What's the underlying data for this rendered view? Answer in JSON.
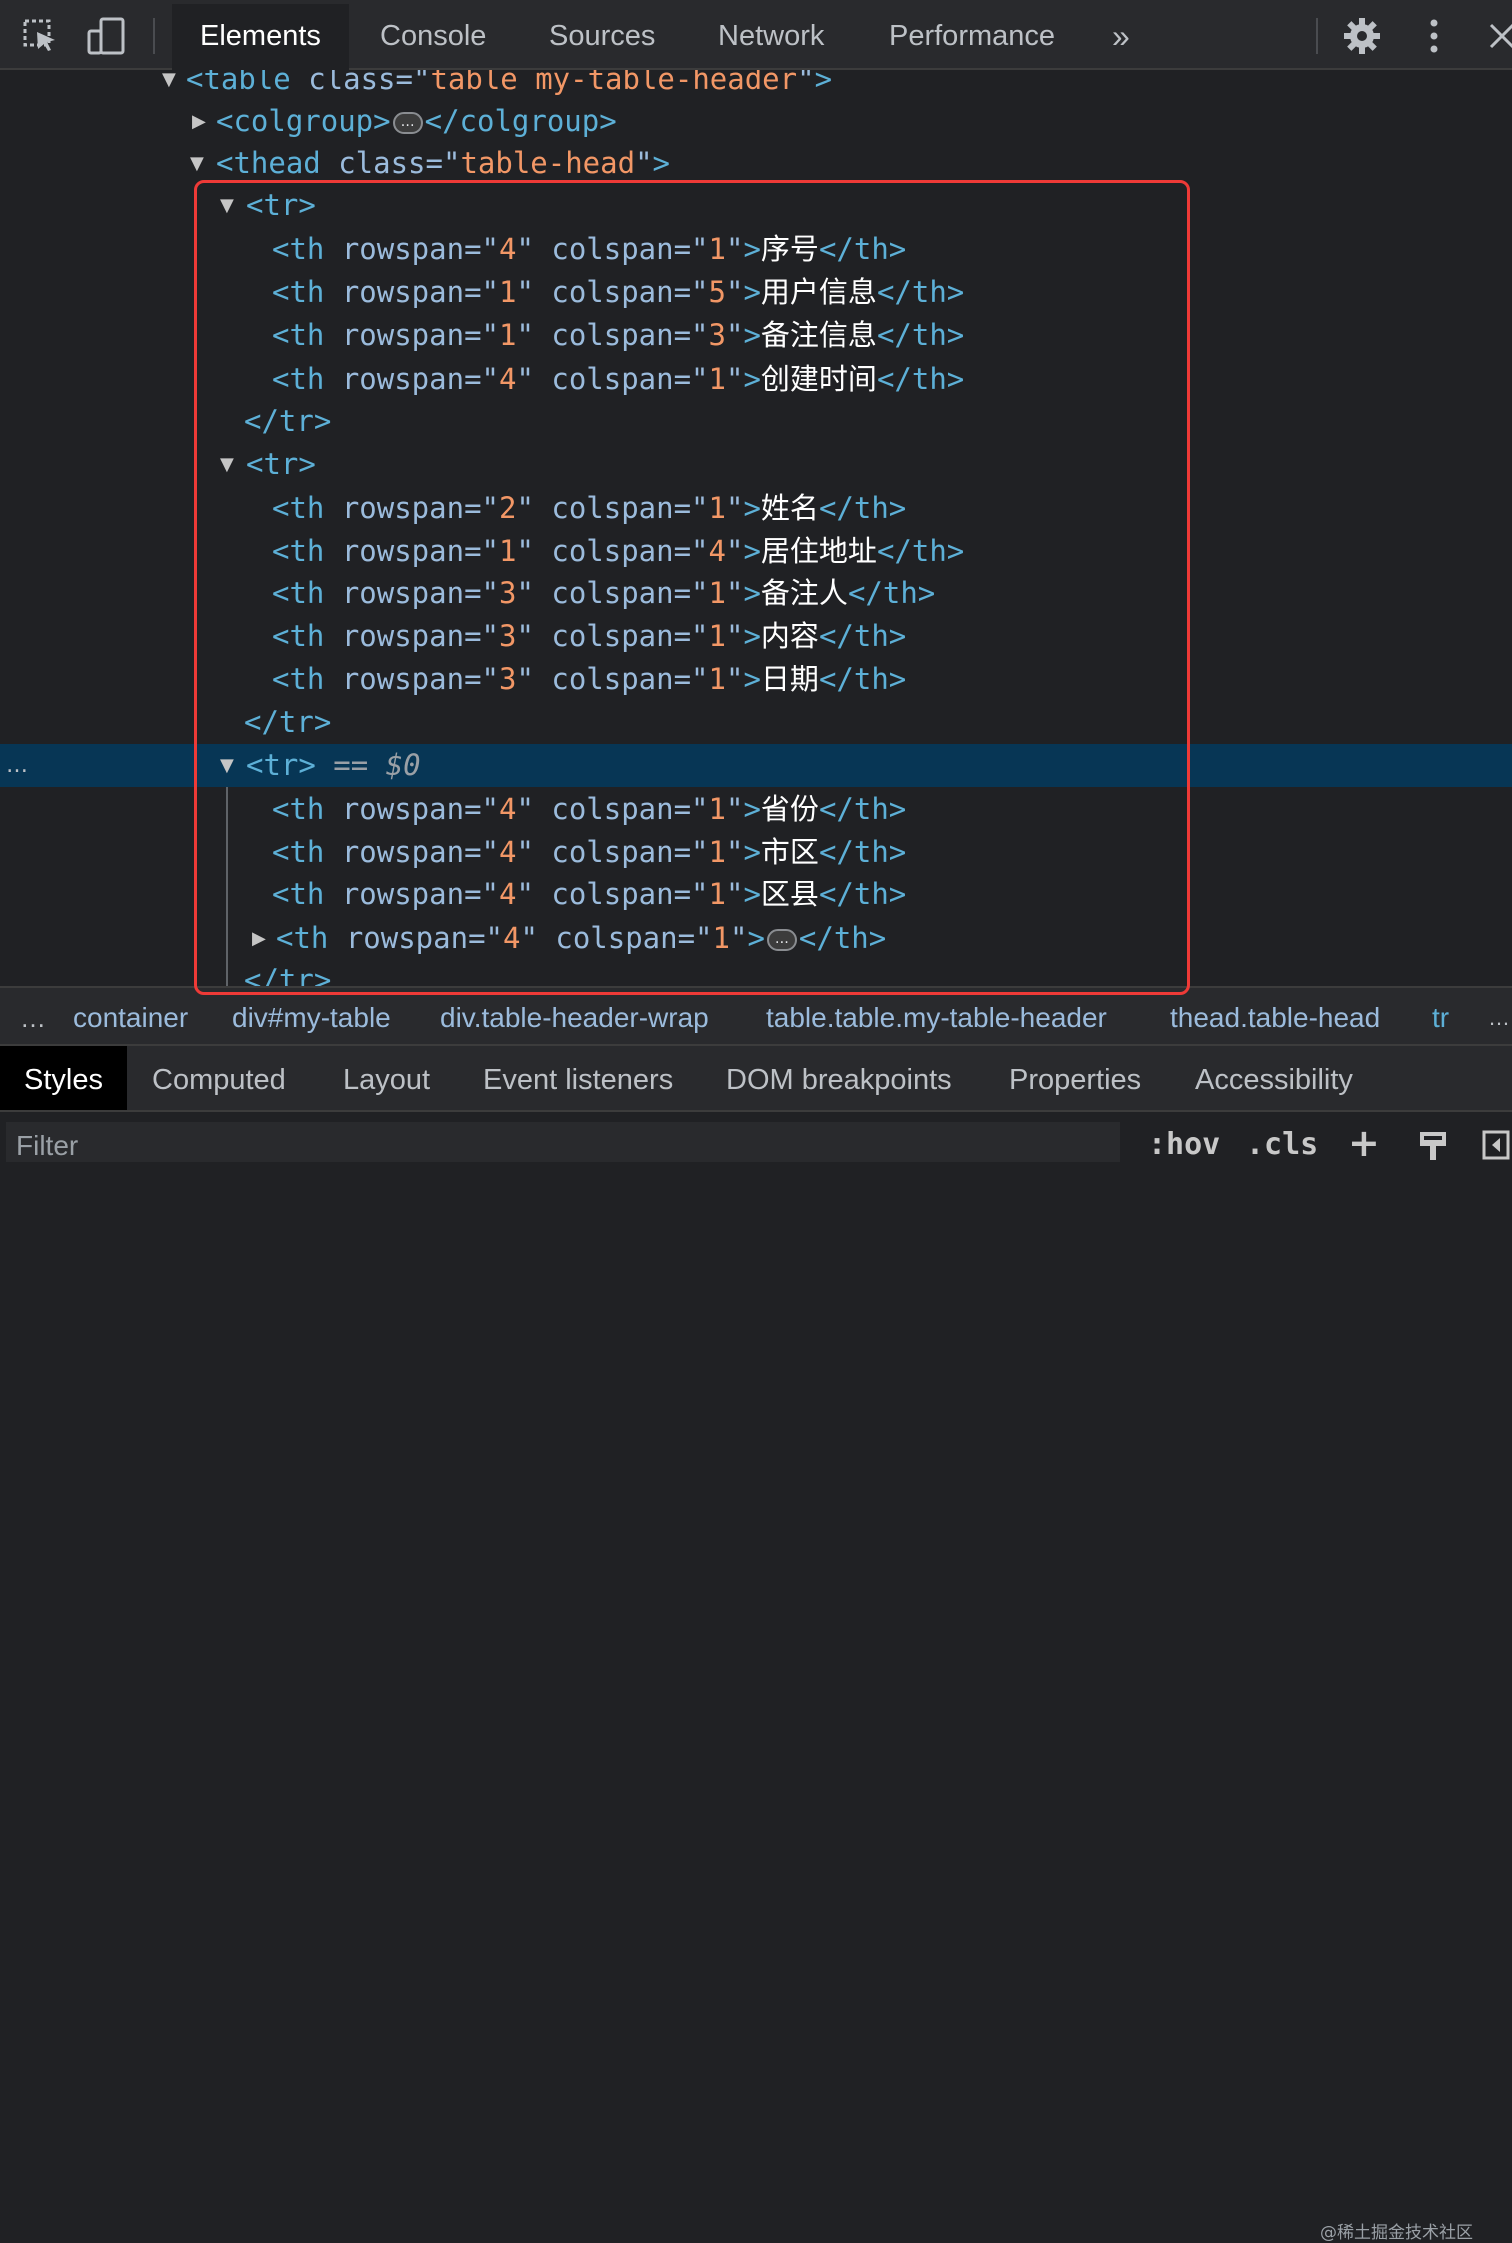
{
  "toolbar": {
    "tabs": [
      "Elements",
      "Console",
      "Sources",
      "Network",
      "Performance"
    ],
    "more_tabs": "»",
    "icons": [
      "inspect-element-icon",
      "device-toggle-icon",
      "gear-icon",
      "kebab-menu-icon",
      "close-icon"
    ]
  },
  "tree": {
    "lines": [
      {
        "segs": [
          {
            "c": "tag",
            "t": "<table "
          },
          {
            "c": "an",
            "t": "class"
          },
          {
            "c": "eq",
            "t": "=\""
          },
          {
            "c": "av",
            "t": "table my-table-header"
          },
          {
            "c": "eq",
            "t": "\""
          },
          {
            "c": "tag",
            "t": ">"
          }
        ]
      },
      {
        "segs": [
          {
            "c": "tag",
            "t": "<colgroup>"
          },
          {
            "c": "ell",
            "t": "…"
          },
          {
            "c": "tag",
            "t": "</colgroup>"
          }
        ]
      },
      {
        "segs": [
          {
            "c": "tag",
            "t": "<thead "
          },
          {
            "c": "an",
            "t": "class"
          },
          {
            "c": "eq",
            "t": "=\""
          },
          {
            "c": "av",
            "t": "table-head"
          },
          {
            "c": "eq",
            "t": "\""
          },
          {
            "c": "tag",
            "t": ">"
          }
        ]
      },
      {
        "segs": [
          {
            "c": "tag",
            "t": "<tr>"
          }
        ]
      },
      {
        "segs": [
          {
            "c": "tag",
            "t": "<th "
          },
          {
            "c": "an",
            "t": "rowspan"
          },
          {
            "c": "eq",
            "t": "=\""
          },
          {
            "c": "av",
            "t": "4"
          },
          {
            "c": "eq",
            "t": "\" "
          },
          {
            "c": "an",
            "t": "colspan"
          },
          {
            "c": "eq",
            "t": "=\""
          },
          {
            "c": "av",
            "t": "1"
          },
          {
            "c": "eq",
            "t": "\""
          },
          {
            "c": "tag",
            "t": ">"
          },
          {
            "c": "txt",
            "t": "序号"
          },
          {
            "c": "tag",
            "t": "</th>"
          }
        ]
      },
      {
        "segs": [
          {
            "c": "tag",
            "t": "<th "
          },
          {
            "c": "an",
            "t": "rowspan"
          },
          {
            "c": "eq",
            "t": "=\""
          },
          {
            "c": "av",
            "t": "1"
          },
          {
            "c": "eq",
            "t": "\" "
          },
          {
            "c": "an",
            "t": "colspan"
          },
          {
            "c": "eq",
            "t": "=\""
          },
          {
            "c": "av",
            "t": "5"
          },
          {
            "c": "eq",
            "t": "\""
          },
          {
            "c": "tag",
            "t": ">"
          },
          {
            "c": "txt",
            "t": "用户信息"
          },
          {
            "c": "tag",
            "t": "</th>"
          }
        ]
      },
      {
        "segs": [
          {
            "c": "tag",
            "t": "<th "
          },
          {
            "c": "an",
            "t": "rowspan"
          },
          {
            "c": "eq",
            "t": "=\""
          },
          {
            "c": "av",
            "t": "1"
          },
          {
            "c": "eq",
            "t": "\" "
          },
          {
            "c": "an",
            "t": "colspan"
          },
          {
            "c": "eq",
            "t": "=\""
          },
          {
            "c": "av",
            "t": "3"
          },
          {
            "c": "eq",
            "t": "\""
          },
          {
            "c": "tag",
            "t": ">"
          },
          {
            "c": "txt",
            "t": "备注信息"
          },
          {
            "c": "tag",
            "t": "</th>"
          }
        ]
      },
      {
        "segs": [
          {
            "c": "tag",
            "t": "<th "
          },
          {
            "c": "an",
            "t": "rowspan"
          },
          {
            "c": "eq",
            "t": "=\""
          },
          {
            "c": "av",
            "t": "4"
          },
          {
            "c": "eq",
            "t": "\" "
          },
          {
            "c": "an",
            "t": "colspan"
          },
          {
            "c": "eq",
            "t": "=\""
          },
          {
            "c": "av",
            "t": "1"
          },
          {
            "c": "eq",
            "t": "\""
          },
          {
            "c": "tag",
            "t": ">"
          },
          {
            "c": "txt",
            "t": "创建时间"
          },
          {
            "c": "tag",
            "t": "</th>"
          }
        ]
      },
      {
        "segs": [
          {
            "c": "tag",
            "t": "</tr>"
          }
        ]
      },
      {
        "segs": [
          {
            "c": "tag",
            "t": "<tr>"
          }
        ]
      },
      {
        "segs": [
          {
            "c": "tag",
            "t": "<th "
          },
          {
            "c": "an",
            "t": "rowspan"
          },
          {
            "c": "eq",
            "t": "=\""
          },
          {
            "c": "av",
            "t": "2"
          },
          {
            "c": "eq",
            "t": "\" "
          },
          {
            "c": "an",
            "t": "colspan"
          },
          {
            "c": "eq",
            "t": "=\""
          },
          {
            "c": "av",
            "t": "1"
          },
          {
            "c": "eq",
            "t": "\""
          },
          {
            "c": "tag",
            "t": ">"
          },
          {
            "c": "txt",
            "t": "姓名"
          },
          {
            "c": "tag",
            "t": "</th>"
          }
        ]
      },
      {
        "segs": [
          {
            "c": "tag",
            "t": "<th "
          },
          {
            "c": "an",
            "t": "rowspan"
          },
          {
            "c": "eq",
            "t": "=\""
          },
          {
            "c": "av",
            "t": "1"
          },
          {
            "c": "eq",
            "t": "\" "
          },
          {
            "c": "an",
            "t": "colspan"
          },
          {
            "c": "eq",
            "t": "=\""
          },
          {
            "c": "av",
            "t": "4"
          },
          {
            "c": "eq",
            "t": "\""
          },
          {
            "c": "tag",
            "t": ">"
          },
          {
            "c": "txt",
            "t": "居住地址"
          },
          {
            "c": "tag",
            "t": "</th>"
          }
        ]
      },
      {
        "segs": [
          {
            "c": "tag",
            "t": "<th "
          },
          {
            "c": "an",
            "t": "rowspan"
          },
          {
            "c": "eq",
            "t": "=\""
          },
          {
            "c": "av",
            "t": "3"
          },
          {
            "c": "eq",
            "t": "\" "
          },
          {
            "c": "an",
            "t": "colspan"
          },
          {
            "c": "eq",
            "t": "=\""
          },
          {
            "c": "av",
            "t": "1"
          },
          {
            "c": "eq",
            "t": "\""
          },
          {
            "c": "tag",
            "t": ">"
          },
          {
            "c": "txt",
            "t": "备注人"
          },
          {
            "c": "tag",
            "t": "</th>"
          }
        ]
      },
      {
        "segs": [
          {
            "c": "tag",
            "t": "<th "
          },
          {
            "c": "an",
            "t": "rowspan"
          },
          {
            "c": "eq",
            "t": "=\""
          },
          {
            "c": "av",
            "t": "3"
          },
          {
            "c": "eq",
            "t": "\" "
          },
          {
            "c": "an",
            "t": "colspan"
          },
          {
            "c": "eq",
            "t": "=\""
          },
          {
            "c": "av",
            "t": "1"
          },
          {
            "c": "eq",
            "t": "\""
          },
          {
            "c": "tag",
            "t": ">"
          },
          {
            "c": "txt",
            "t": "内容"
          },
          {
            "c": "tag",
            "t": "</th>"
          }
        ]
      },
      {
        "segs": [
          {
            "c": "tag",
            "t": "<th "
          },
          {
            "c": "an",
            "t": "rowspan"
          },
          {
            "c": "eq",
            "t": "=\""
          },
          {
            "c": "av",
            "t": "3"
          },
          {
            "c": "eq",
            "t": "\" "
          },
          {
            "c": "an",
            "t": "colspan"
          },
          {
            "c": "eq",
            "t": "=\""
          },
          {
            "c": "av",
            "t": "1"
          },
          {
            "c": "eq",
            "t": "\""
          },
          {
            "c": "tag",
            "t": ">"
          },
          {
            "c": "txt",
            "t": "日期"
          },
          {
            "c": "tag",
            "t": "</th>"
          }
        ]
      },
      {
        "segs": [
          {
            "c": "tag",
            "t": "</tr>"
          }
        ]
      },
      {
        "segs": [
          {
            "c": "tag",
            "t": "<tr>"
          },
          {
            "c": "dim",
            "t": " == "
          },
          {
            "c": "dim",
            "t": "$0"
          }
        ]
      },
      {
        "segs": [
          {
            "c": "tag",
            "t": "<th "
          },
          {
            "c": "an",
            "t": "rowspan"
          },
          {
            "c": "eq",
            "t": "=\""
          },
          {
            "c": "av",
            "t": "4"
          },
          {
            "c": "eq",
            "t": "\" "
          },
          {
            "c": "an",
            "t": "colspan"
          },
          {
            "c": "eq",
            "t": "=\""
          },
          {
            "c": "av",
            "t": "1"
          },
          {
            "c": "eq",
            "t": "\""
          },
          {
            "c": "tag",
            "t": ">"
          },
          {
            "c": "txt",
            "t": "省份"
          },
          {
            "c": "tag",
            "t": "</th>"
          }
        ]
      },
      {
        "segs": [
          {
            "c": "tag",
            "t": "<th "
          },
          {
            "c": "an",
            "t": "rowspan"
          },
          {
            "c": "eq",
            "t": "=\""
          },
          {
            "c": "av",
            "t": "4"
          },
          {
            "c": "eq",
            "t": "\" "
          },
          {
            "c": "an",
            "t": "colspan"
          },
          {
            "c": "eq",
            "t": "=\""
          },
          {
            "c": "av",
            "t": "1"
          },
          {
            "c": "eq",
            "t": "\""
          },
          {
            "c": "tag",
            "t": ">"
          },
          {
            "c": "txt",
            "t": "市区"
          },
          {
            "c": "tag",
            "t": "</th>"
          }
        ]
      },
      {
        "segs": [
          {
            "c": "tag",
            "t": "<th "
          },
          {
            "c": "an",
            "t": "rowspan"
          },
          {
            "c": "eq",
            "t": "=\""
          },
          {
            "c": "av",
            "t": "4"
          },
          {
            "c": "eq",
            "t": "\" "
          },
          {
            "c": "an",
            "t": "colspan"
          },
          {
            "c": "eq",
            "t": "=\""
          },
          {
            "c": "av",
            "t": "1"
          },
          {
            "c": "eq",
            "t": "\""
          },
          {
            "c": "tag",
            "t": ">"
          },
          {
            "c": "txt",
            "t": "区县"
          },
          {
            "c": "tag",
            "t": "</th>"
          }
        ]
      },
      {
        "segs": [
          {
            "c": "tag",
            "t": "<th "
          },
          {
            "c": "an",
            "t": "rowspan"
          },
          {
            "c": "eq",
            "t": "=\""
          },
          {
            "c": "av",
            "t": "4"
          },
          {
            "c": "eq",
            "t": "\" "
          },
          {
            "c": "an",
            "t": "colspan"
          },
          {
            "c": "eq",
            "t": "=\""
          },
          {
            "c": "av",
            "t": "1"
          },
          {
            "c": "eq",
            "t": "\""
          },
          {
            "c": "tag",
            "t": ">"
          },
          {
            "c": "ell",
            "t": "…"
          },
          {
            "c": "tag",
            "t": "</th>"
          }
        ]
      },
      {
        "segs": [
          {
            "c": "tag",
            "t": "</tr>"
          }
        ]
      }
    ],
    "selected_indicator": "…"
  },
  "breadcrumbs": {
    "leading": "…",
    "items": [
      {
        "label": "container",
        "kind": "class"
      },
      {
        "label": "div#my-table",
        "kind": "id"
      },
      {
        "label": "div.table-header-wrap",
        "kind": "class"
      },
      {
        "label": "table.table.my-table-header",
        "kind": "class"
      },
      {
        "label": "thead.table-head",
        "kind": "class"
      },
      {
        "label": "tr",
        "kind": "tag"
      }
    ],
    "trailing": "…"
  },
  "styles_tabs": [
    "Styles",
    "Computed",
    "Layout",
    "Event listeners",
    "DOM breakpoints",
    "Properties",
    "Accessibility"
  ],
  "filter": {
    "placeholder": "Filter",
    "hov_label": ":hov",
    "cls_label": ".cls",
    "add_label": "+"
  },
  "watermark": "@稀土掘金技术社区"
}
